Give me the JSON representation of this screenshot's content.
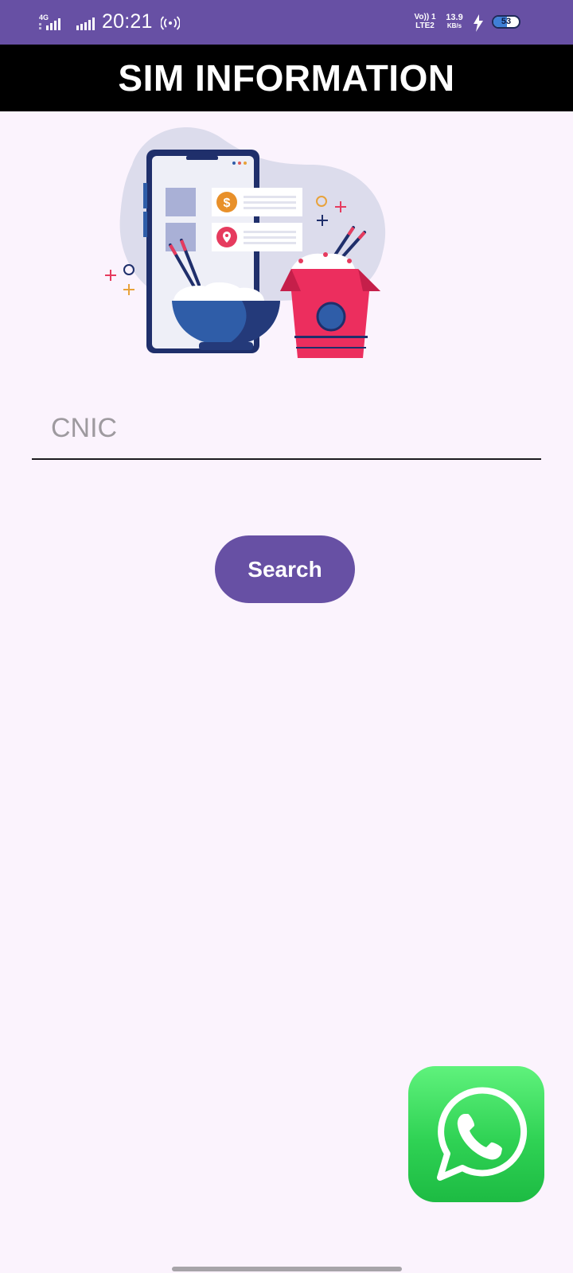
{
  "status_bar": {
    "network": "4G",
    "time": "20:21",
    "volte_line1": "Vo)) 1",
    "volte_line2": "LTE2",
    "speed_value": "13.9",
    "speed_unit": "KB/s",
    "battery": "53",
    "battery_level": 0.53,
    "icons": [
      "signal-icon",
      "signal-icon-sim2",
      "hotspot-icon",
      "charging-icon",
      "battery-icon"
    ]
  },
  "app": {
    "title": "SIM INFORMATION"
  },
  "form": {
    "cnic_placeholder": "CNIC",
    "cnic_value": "",
    "search_label": "Search"
  },
  "colors": {
    "primary": "#6750a4",
    "title_bar": "#000000",
    "background": "#fbf3fd",
    "whatsapp_green": "#25d366"
  },
  "floating": {
    "whatsapp_icon": "whatsapp-icon"
  }
}
